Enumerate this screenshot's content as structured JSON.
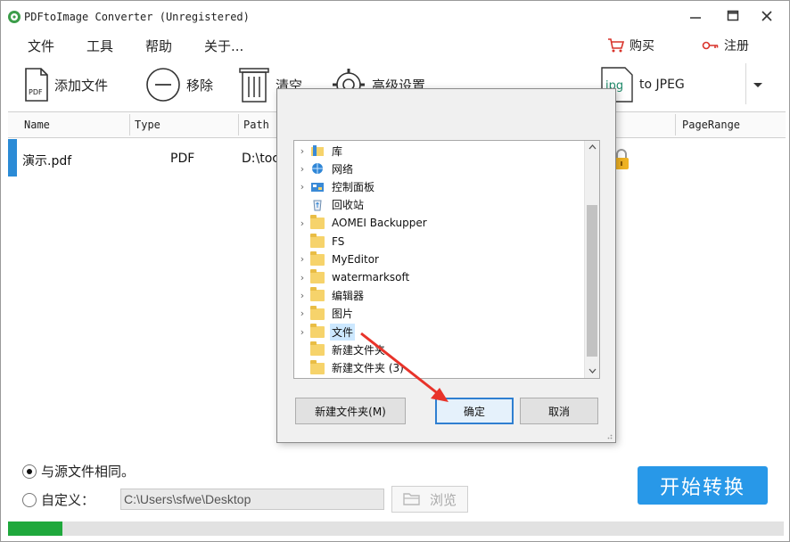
{
  "window": {
    "title": "PDFtoImage Converter (Unregistered)",
    "app_icon": "app-logo-icon",
    "controls": [
      "minimize-icon",
      "maximize-icon",
      "close-icon"
    ]
  },
  "menu": {
    "items": [
      "文件",
      "工具",
      "帮助",
      "关于..."
    ],
    "buy_label": "购买",
    "register_label": "注册"
  },
  "toolbar": {
    "add_files": "添加文件",
    "remove": "移除",
    "clear": "清空",
    "advanced": "高级设置",
    "format_label": "to JPEG",
    "format_icon_text": "jpg"
  },
  "table": {
    "columns": [
      "Name",
      "Type",
      "Path",
      "PageRange"
    ],
    "rows": [
      {
        "name": "演示.pdf",
        "type": "PDF",
        "path": "D:\\toc"
      }
    ]
  },
  "output": {
    "same_as_source_label": "与源文件相同。",
    "custom_label": "自定义：",
    "custom_path": "C:\\Users\\sfwe\\Desktop",
    "browse_label": "浏览",
    "selected_option": "same_as_source"
  },
  "start_button": "开始转换",
  "progress": {
    "fraction": 0.07,
    "color": "#1fa83c"
  },
  "dialog": {
    "tree_items": [
      {
        "label": "库",
        "icon": "library-icon",
        "expandable": true
      },
      {
        "label": "网络",
        "icon": "network-icon",
        "expandable": true
      },
      {
        "label": "控制面板",
        "icon": "control-panel-icon",
        "expandable": true
      },
      {
        "label": "回收站",
        "icon": "recycle-bin-icon",
        "expandable": false
      },
      {
        "label": "AOMEI Backupper",
        "icon": "folder-icon",
        "expandable": true
      },
      {
        "label": "FS",
        "icon": "folder-icon",
        "expandable": false
      },
      {
        "label": "MyEditor",
        "icon": "folder-icon",
        "expandable": true
      },
      {
        "label": "watermarksoft",
        "icon": "folder-icon",
        "expandable": true
      },
      {
        "label": "编辑器",
        "icon": "folder-icon",
        "expandable": true
      },
      {
        "label": "图片",
        "icon": "folder-icon",
        "expandable": true
      },
      {
        "label": "文件",
        "icon": "folder-icon",
        "expandable": true,
        "selected": true
      },
      {
        "label": "新建文件夹",
        "icon": "folder-icon",
        "expandable": false
      },
      {
        "label": "新建文件夹 (3)",
        "icon": "folder-icon",
        "expandable": false
      }
    ],
    "new_folder_button": "新建文件夹(M)",
    "ok_button": "确定",
    "cancel_button": "取消"
  },
  "colors": {
    "accent": "#2898e8",
    "selection_marker": "#2b8bd6",
    "annotation_arrow": "#e8332a"
  }
}
